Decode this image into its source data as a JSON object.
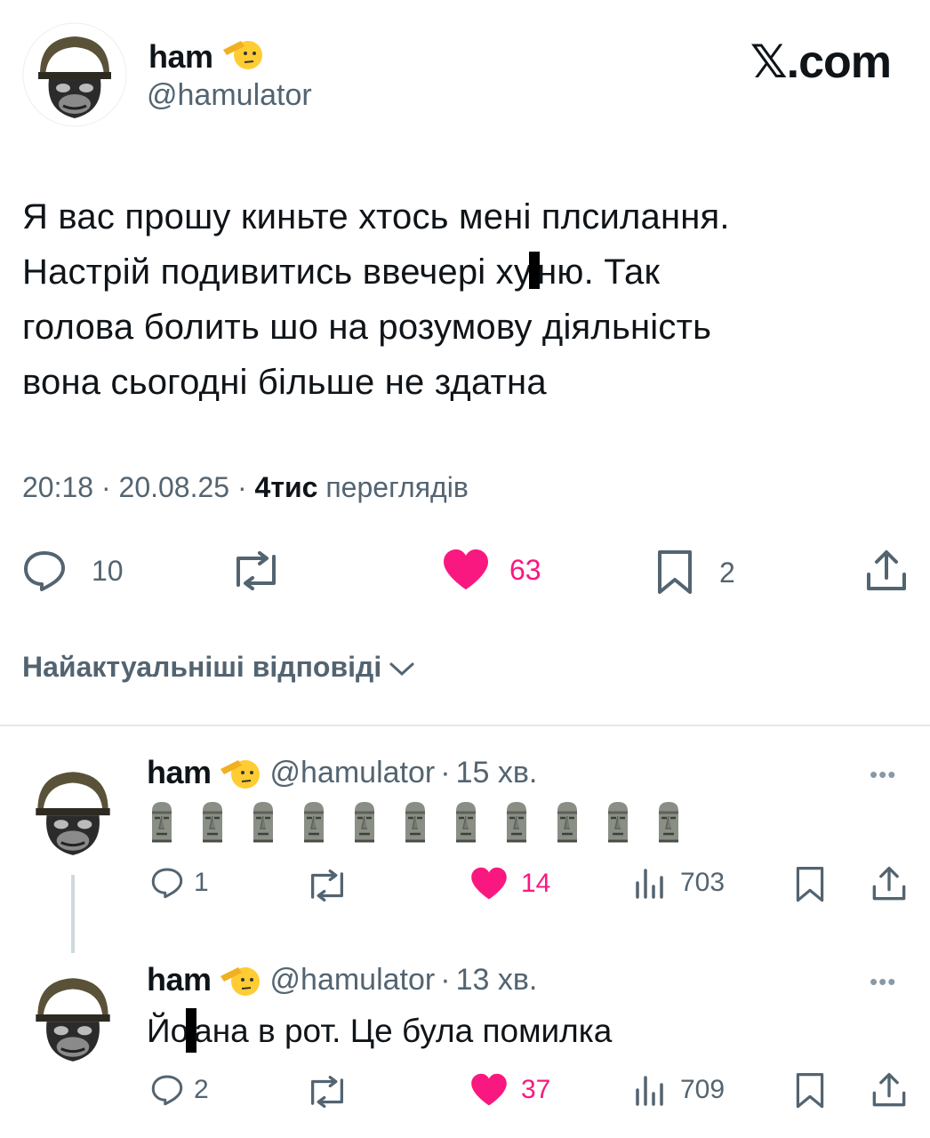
{
  "brand": {
    "watermark": "𝕏.com"
  },
  "colors": {
    "like": "#f91880",
    "secondary": "#536471",
    "text": "#0f1419"
  },
  "main_tweet": {
    "author_name": "ham",
    "author_handle": "@hamulator",
    "badge_icon": "saluting-face-emoji",
    "text_line1": "Я вас прошу киньте хтось мені плсилання.",
    "text_line2_a": "Настрій подивитись ввечері ху",
    "text_line2_b": "ню. Так",
    "text_line3": "голова болить шо на розумову діяльність",
    "text_line4": "вона сьогодні більше не здатна",
    "time": "20:18",
    "date": "20.08.25",
    "views_count": "4тис",
    "views_label": "переглядів",
    "sep": "·",
    "replies": "10",
    "likes": "63",
    "bookmarks": "2"
  },
  "replies_sort_label": "Найактуальніші відповіді",
  "replies": [
    {
      "author_name": "ham",
      "author_handle": "@hamulator",
      "sep": "·",
      "time_ago": "15 хв.",
      "emoji_icon": "moai-emoji",
      "emoji_count_visible": 11,
      "replies": "1",
      "likes": "14",
      "views": "703"
    },
    {
      "author_name": "ham",
      "author_handle": "@hamulator",
      "sep": "·",
      "time_ago": "13 хв.",
      "text_a": "Йо",
      "text_b": "ана в рот. Це була помилка",
      "replies": "2",
      "likes": "37",
      "views": "709"
    }
  ]
}
